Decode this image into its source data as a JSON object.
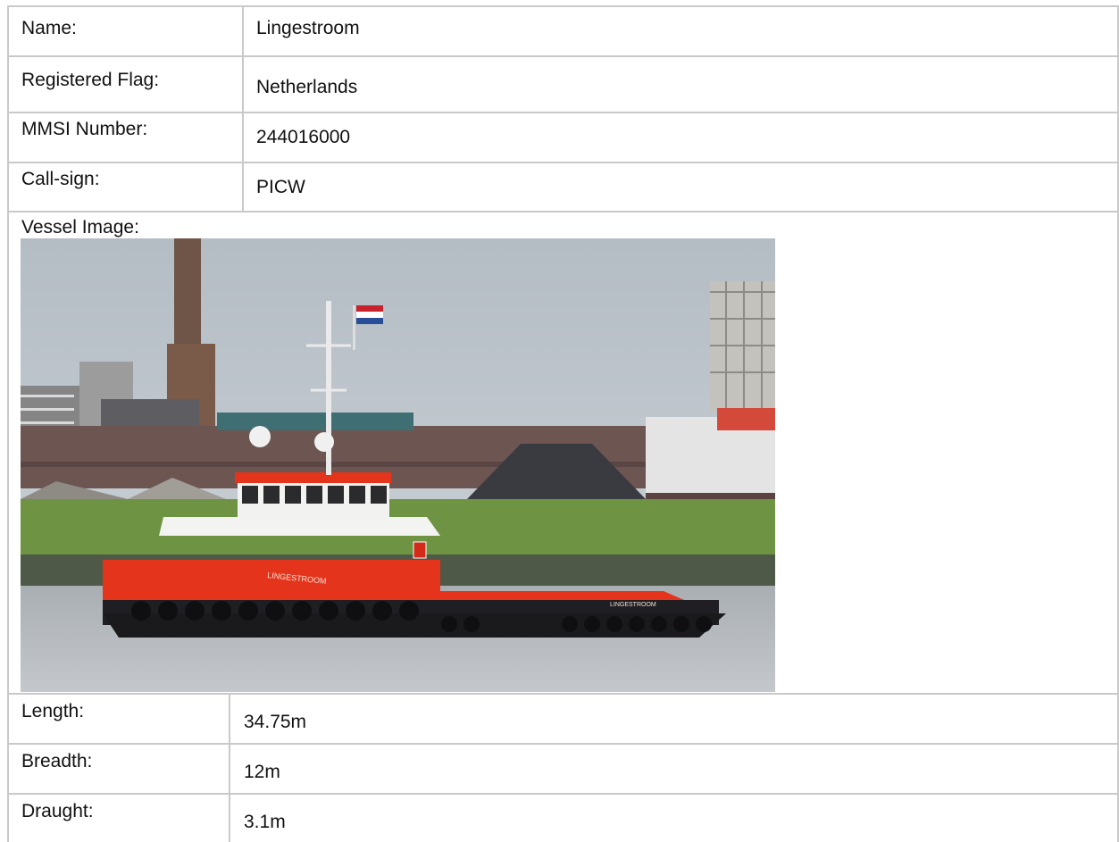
{
  "vessel": {
    "name": {
      "label": "Name:",
      "value": "Lingestroom"
    },
    "flag": {
      "label": "Registered Flag:",
      "value": "Netherlands"
    },
    "mmsi": {
      "label": "MMSI Number:",
      "value": "244016000"
    },
    "callsign": {
      "label": "Call-sign:",
      "value": "PICW"
    },
    "image": {
      "label": "Vessel Image:",
      "hull_text": "LINGESTROOM",
      "stern_text": "LINGESTROOM"
    },
    "length": {
      "label": "Length:",
      "value": "34.75m"
    },
    "breadth": {
      "label": "Breadth:",
      "value": "12m"
    },
    "draught": {
      "label": "Draught:",
      "value": "3.1m"
    }
  },
  "colors": {
    "border": "#c9c9c9",
    "hull": "#e5341c",
    "text": "#111111"
  }
}
